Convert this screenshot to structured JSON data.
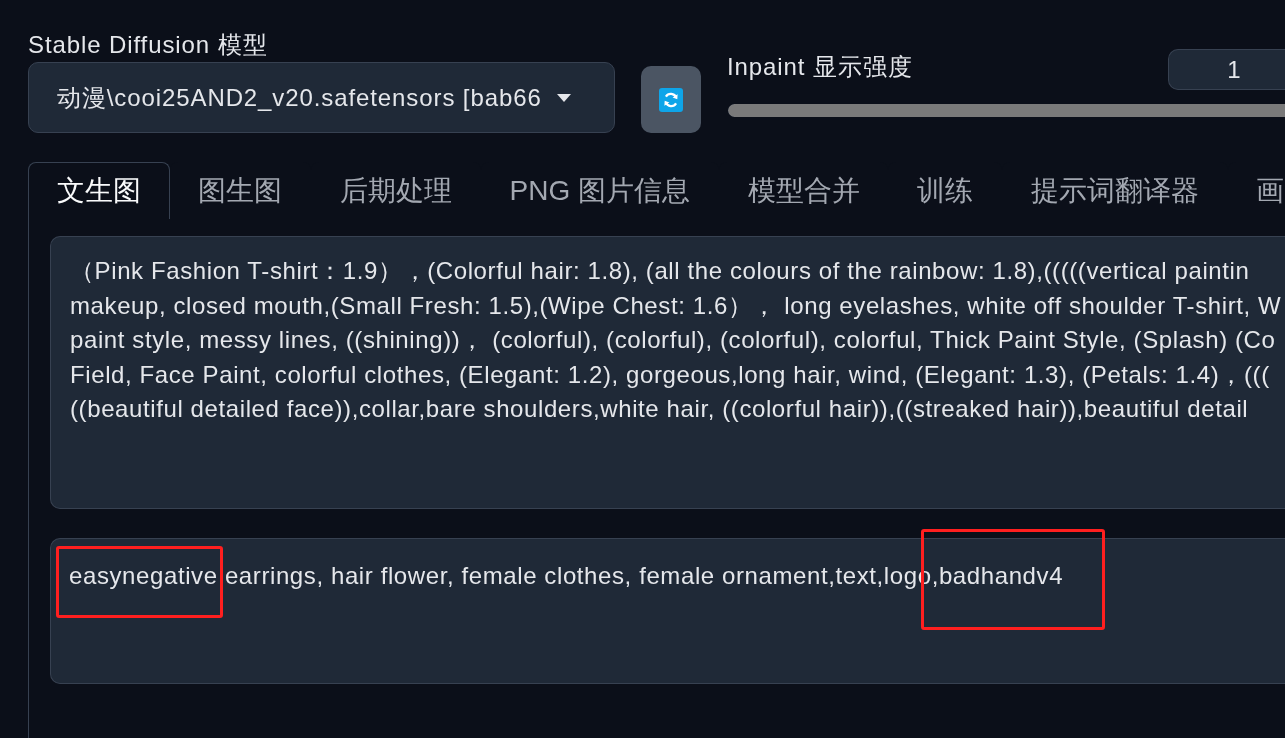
{
  "model_selector": {
    "label": "Stable Diffusion 模型",
    "value": "动漫\\cooi25AND2_v20.safetensors [bab66"
  },
  "inpaint_strength": {
    "label": "Inpaint 显示强度",
    "value": "1",
    "level": 1
  },
  "tabs": [
    {
      "label": "文生图",
      "selected": true
    },
    {
      "label": "图生图",
      "selected": false
    },
    {
      "label": "后期处理",
      "selected": false
    },
    {
      "label": "PNG 图片信息",
      "selected": false
    },
    {
      "label": "模型合并",
      "selected": false
    },
    {
      "label": "训练",
      "selected": false
    },
    {
      "label": "提示词翻译器",
      "selected": false
    },
    {
      "label": "画",
      "selected": false
    }
  ],
  "prompt": {
    "lines": [
      "（Pink Fashion T-shirt：1.9），(Colorful hair: 1.8), (all the colours of the rainbow: 1.8),(((((vertical paintin",
      "makeup, closed mouth,(Small Fresh: 1.5),(Wipe Chest: 1.6）， long eyelashes, white off shoulder T-shirt, W",
      "paint style, messy lines, ((shining))， (colorful), (colorful), (colorful), colorful, Thick Paint Style, (Splash) (Co",
      "Field, Face Paint, colorful clothes, (Elegant: 1.2), gorgeous,long hair, wind, (Elegant: 1.3), (Petals: 1.4)，(((",
      "((beautiful detailed face)),collar,bare shoulders,white hair, ((colorful hair)),((streaked hair)),beautiful detail"
    ]
  },
  "negative_prompt": {
    "segments": [
      {
        "text": "easynegative",
        "highlighted": true
      },
      {
        "text": " earrings, hair flower, female clothes, female ornament,text,logo",
        "highlighted": false
      },
      {
        "text": ",badhandv4",
        "highlighted": true
      }
    ]
  }
}
